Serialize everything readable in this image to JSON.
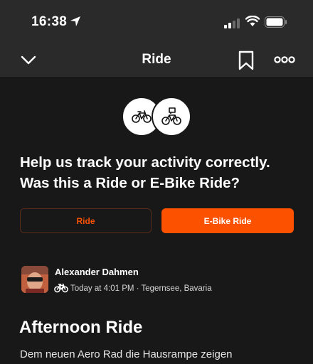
{
  "status_bar": {
    "time": "16:38"
  },
  "nav": {
    "title": "Ride"
  },
  "prompt": {
    "line1": "Help us track your activity correctly.",
    "line2": "Was this a Ride or E-Bike Ride?"
  },
  "options": {
    "ride_label": "Ride",
    "ebike_label": "E-Bike Ride"
  },
  "athlete": {
    "name": "Alexander Dahmen",
    "meta": "Today at 4:01 PM · Tegernsee, Bavaria"
  },
  "activity": {
    "title": "Afternoon Ride",
    "description": "Dem neuen Aero Rad die Hausrampe zeigen"
  },
  "colors": {
    "accent": "#fc5200",
    "background": "#181818",
    "header": "#2a2a2a"
  },
  "icons": [
    "location-arrow-icon",
    "signal-icon",
    "wifi-icon",
    "battery-icon",
    "chevron-down-icon",
    "bookmark-icon",
    "more-icon",
    "bike-icon",
    "ebike-icon"
  ]
}
